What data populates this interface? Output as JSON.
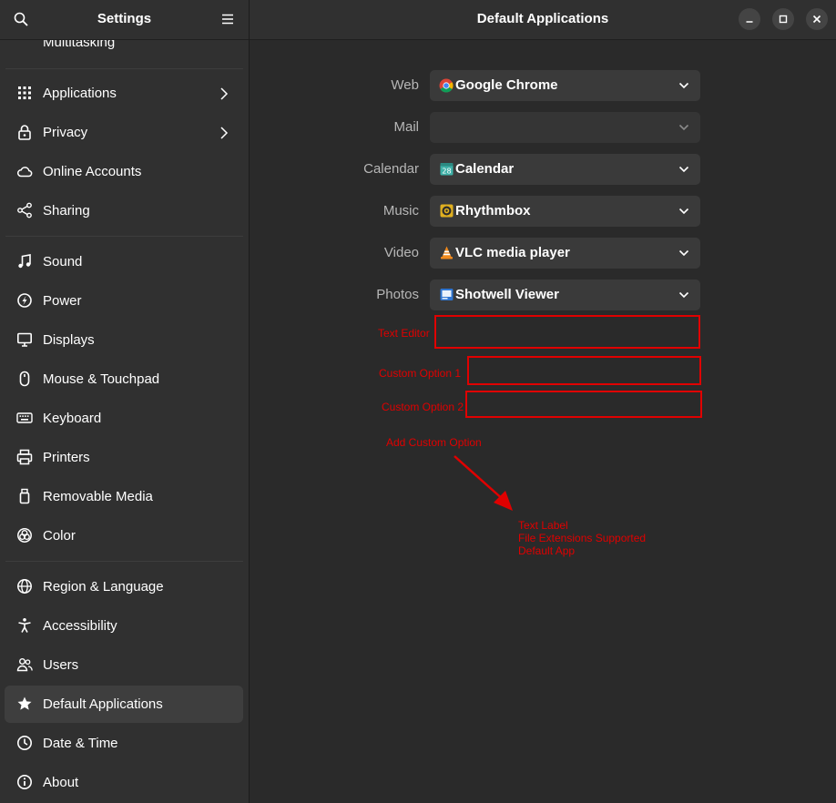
{
  "sidebar": {
    "title": "Settings",
    "items": [
      {
        "label": "Multitasking",
        "icon": "multitasking-icon"
      },
      {
        "label": "Applications",
        "icon": "apps-grid-icon",
        "chevron": true
      },
      {
        "label": "Privacy",
        "icon": "lock-icon",
        "chevron": true
      },
      {
        "label": "Online Accounts",
        "icon": "cloud-icon"
      },
      {
        "label": "Sharing",
        "icon": "share-icon"
      },
      {
        "label": "Sound",
        "icon": "music-note-icon"
      },
      {
        "label": "Power",
        "icon": "power-icon"
      },
      {
        "label": "Displays",
        "icon": "monitor-icon"
      },
      {
        "label": "Mouse & Touchpad",
        "icon": "mouse-icon"
      },
      {
        "label": "Keyboard",
        "icon": "keyboard-icon"
      },
      {
        "label": "Printers",
        "icon": "printer-icon"
      },
      {
        "label": "Removable Media",
        "icon": "usb-drive-icon"
      },
      {
        "label": "Color",
        "icon": "color-icon"
      },
      {
        "label": "Region & Language",
        "icon": "globe-icon"
      },
      {
        "label": "Accessibility",
        "icon": "accessibility-icon"
      },
      {
        "label": "Users",
        "icon": "users-icon"
      },
      {
        "label": "Default Applications",
        "icon": "star-icon",
        "selected": true
      },
      {
        "label": "Date & Time",
        "icon": "clock-icon"
      },
      {
        "label": "About",
        "icon": "info-icon"
      }
    ]
  },
  "main": {
    "title": "Default Applications",
    "rows": [
      {
        "label": "Web",
        "value": "Google Chrome",
        "icon": "chrome-icon"
      },
      {
        "label": "Mail",
        "value": "",
        "icon": ""
      },
      {
        "label": "Calendar",
        "value": "Calendar",
        "icon": "calendar-icon"
      },
      {
        "label": "Music",
        "value": "Rhythmbox",
        "icon": "rhythmbox-icon"
      },
      {
        "label": "Video",
        "value": "VLC media player",
        "icon": "vlc-icon"
      },
      {
        "label": "Photos",
        "value": "Shotwell Viewer",
        "icon": "shotwell-icon"
      }
    ],
    "calendar_icon_day": "28"
  },
  "annotations": {
    "text_editor": "Text Editor",
    "custom_option_1": "Custom Option 1",
    "custom_option_2": "Custom Option 2",
    "add_custom_option": "Add Custom Option",
    "note_lines": [
      "Text Label",
      "File Extensions Supported",
      "Default App"
    ]
  },
  "colors": {
    "annotation_red": "#e00000",
    "sidebar_bg": "#303030",
    "main_bg": "#2a2a2a",
    "selected_bg": "#3e3e3e"
  }
}
